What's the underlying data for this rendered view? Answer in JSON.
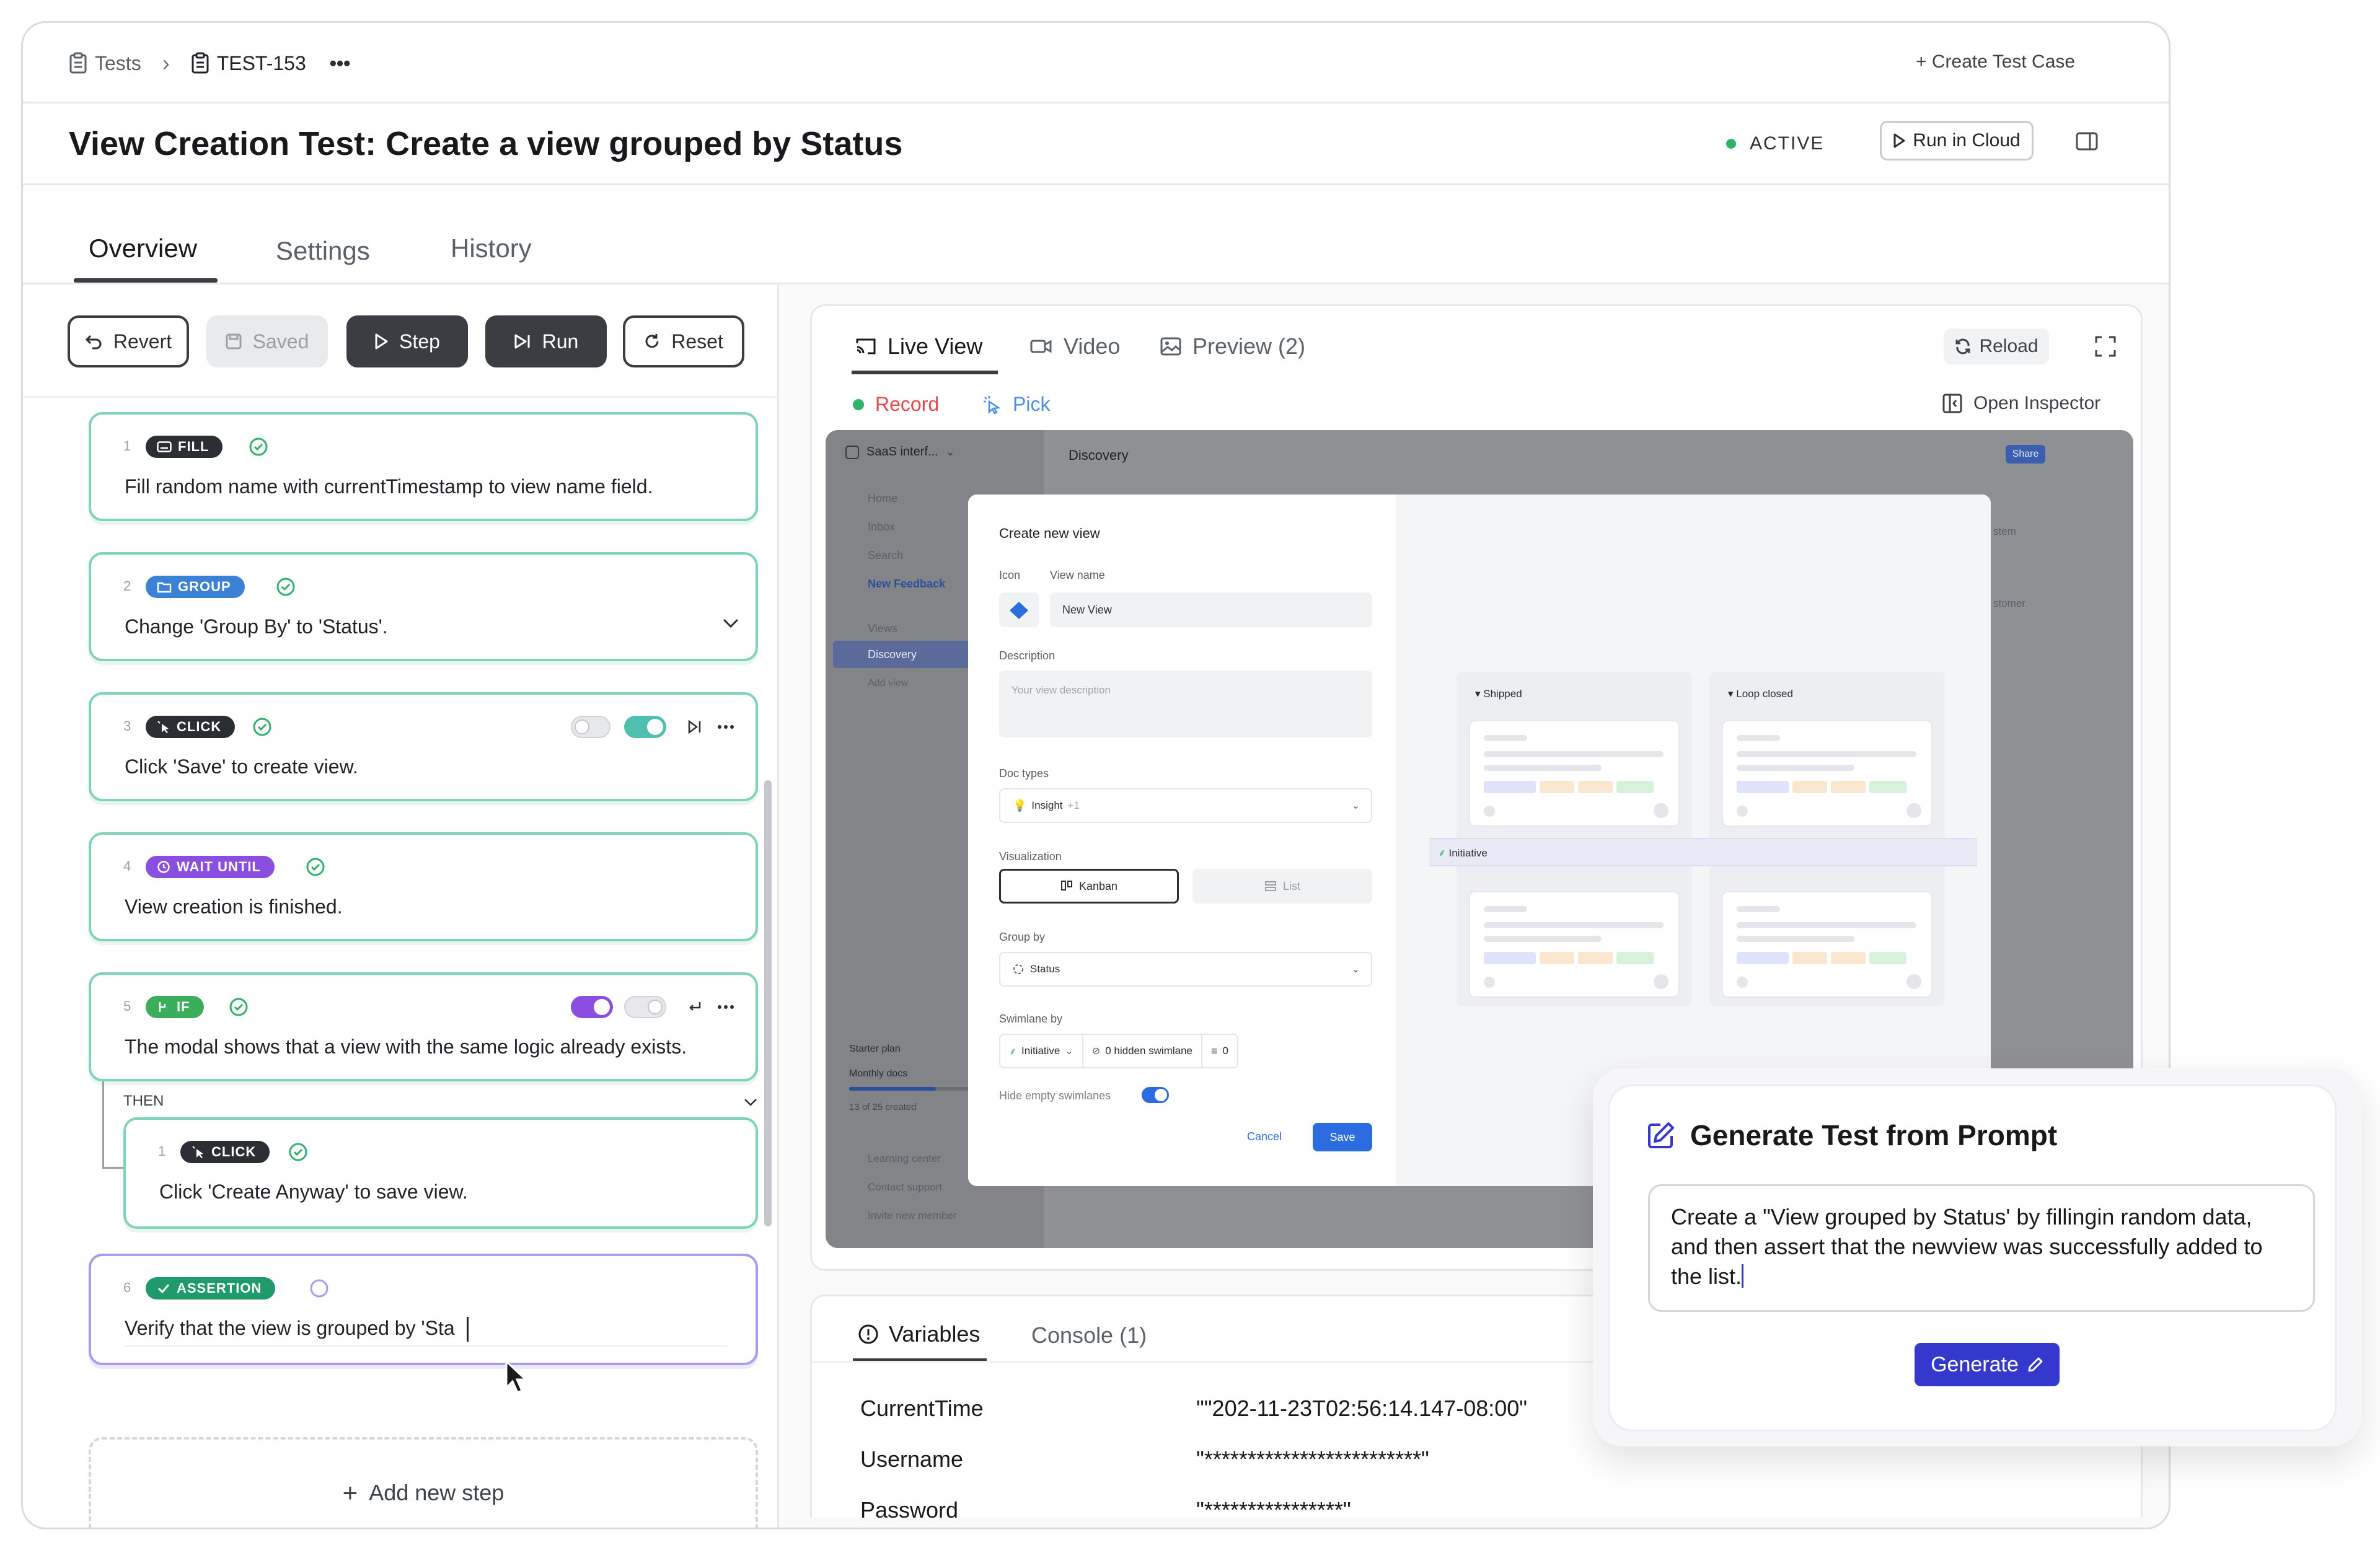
{
  "breadcrumb": {
    "root": "Tests",
    "separator": "›",
    "current": "TEST-153",
    "more": "•••"
  },
  "header": {
    "create_test_case": "+ Create Test Case"
  },
  "title": "View Creation Test: Create a view grouped by Status",
  "status": {
    "label": "ACTIVE",
    "color": "#2fb36a"
  },
  "run_in_cloud": "Run in Cloud",
  "tabs": [
    "Overview",
    "Settings",
    "History"
  ],
  "toolbar": {
    "revert": "Revert",
    "saved": "Saved",
    "step": "Step",
    "run": "Run",
    "reset": "Reset"
  },
  "steps": [
    {
      "num": "1",
      "type": "FILL",
      "text": "Fill random name with currentTimestamp to view name field."
    },
    {
      "num": "2",
      "type": "GROUP",
      "text": "Change 'Group By' to 'Status'."
    },
    {
      "num": "3",
      "type": "CLICK",
      "text": "Click 'Save' to create view."
    },
    {
      "num": "4",
      "type": "WAIT UNTIL",
      "text": "View creation is finished."
    },
    {
      "num": "5",
      "type": "IF",
      "text": "The modal shows that a view with the same logic already exists."
    },
    {
      "num": "1",
      "type": "CLICK",
      "text": "Click 'Create Anyway' to save view."
    },
    {
      "num": "6",
      "type": "ASSERTION",
      "text": "Verify that the view is grouped by 'Sta"
    }
  ],
  "then_label": "THEN",
  "add_step": "Add new step",
  "preview": {
    "tabs": [
      "Live View",
      "Video",
      "Preview (2)"
    ],
    "reload": "Reload",
    "record": "Record",
    "pick": "Pick",
    "open_inspector": "Open Inspector"
  },
  "mock_app": {
    "workspace": "SaaS interf...",
    "nav": [
      "Home",
      "Inbox",
      "Search",
      "New Feedback"
    ],
    "views_label": "Views",
    "views": [
      "Discovery",
      "Add view"
    ],
    "page_title": "Discovery",
    "share": "Share",
    "plan": "Starter plan",
    "monthly_docs": "Monthly docs",
    "docs_created": "13 of 25 created",
    "footer_links": [
      "Learning center",
      "Contact support",
      "Invite new member"
    ],
    "right_cards": [
      "stem",
      "stomer"
    ]
  },
  "modal": {
    "title": "Create new view",
    "icon_label": "Icon",
    "view_name_label": "View name",
    "view_name_value": "New View",
    "description_label": "Description",
    "description_placeholder": "Your view description",
    "doc_types_label": "Doc types",
    "doc_types_value": "Insight",
    "doc_types_extra": "+1",
    "visualization_label": "Visualization",
    "kanban": "Kanban",
    "list": "List",
    "group_by_label": "Group by",
    "group_by_value": "Status",
    "swimlane_label": "Swimlane by",
    "swimlane_value": "Initiative",
    "hidden_swimlane": "0 hidden swimlane",
    "filter_count": "0",
    "hide_empty": "Hide empty swimlanes",
    "cancel": "Cancel",
    "save": "Save",
    "columns": [
      "Shipped",
      "Loop closed"
    ],
    "swimlane_row": "Initiative"
  },
  "variables": {
    "tabs": [
      "Variables",
      "Console (1)"
    ],
    "rows": [
      {
        "key": "CurrentTime",
        "value": "\"\"202-11-23T02:56:14.147-08:00\""
      },
      {
        "key": "Username",
        "value": "\"*************************\""
      },
      {
        "key": "Password",
        "value": "\"****************\""
      }
    ]
  },
  "generate": {
    "title": "Generate Test from Prompt",
    "prompt": "Create a \"View grouped by Status' by fillingin random data, and then assert that the newview was successfully added to the list.",
    "button": "Generate"
  },
  "colors": {
    "fill": "#2b2e33",
    "group": "#3b82d6",
    "click": "#2b2e33",
    "wait": "#8a4fe0",
    "if": "#3aae5a",
    "assertion": "#1f9a6a",
    "accent": "#3538cd",
    "record": "#e5484d",
    "pick": "#4b8fe2"
  }
}
